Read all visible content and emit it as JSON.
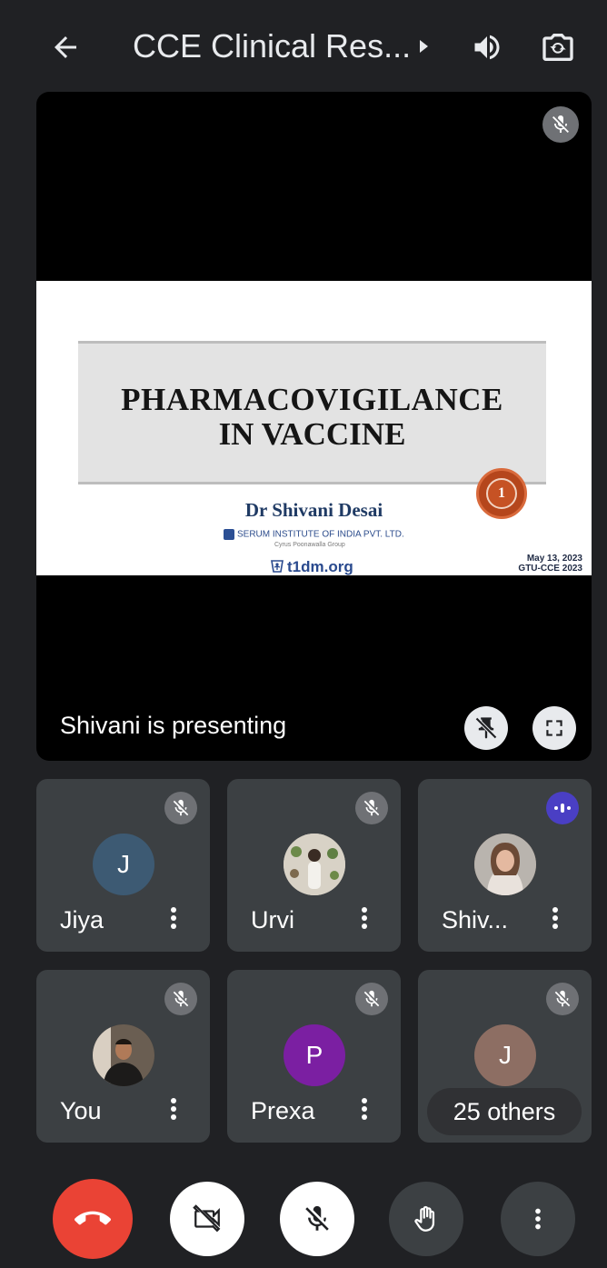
{
  "header": {
    "title": "CCE Clinical Res..."
  },
  "stage": {
    "slide": {
      "title_line1": "PHARMACOVIGILANCE",
      "title_line2": "IN VACCINE",
      "badge_number": "1",
      "author": "Dr Shivani Desai",
      "org": "SERUM INSTITUTE OF INDIA PVT. LTD.",
      "org_sub": "Cyrus Poonawalla Group",
      "site": "t1dm.org",
      "date_line1": "May 13, 2023",
      "date_line2": "GTU-CCE 2023"
    },
    "presenting_label": "Shivani is presenting"
  },
  "participants": [
    {
      "name": "Jiya",
      "initial": "J",
      "avatar_color": "#3d5a73",
      "state": "muted"
    },
    {
      "name": "Urvi",
      "initial": "",
      "avatar_color": "#c7c2b8",
      "state": "muted"
    },
    {
      "name": "Shiv...",
      "initial": "",
      "avatar_color": "#8a6b5c",
      "state": "speaking"
    },
    {
      "name": "You",
      "initial": "",
      "avatar_color": "#2c2a28",
      "state": "muted"
    },
    {
      "name": "Prexa",
      "initial": "P",
      "avatar_color": "#7b1fa2",
      "state": "muted"
    },
    {
      "name": "",
      "initial": "J",
      "avatar_color": "#8d6e63",
      "state": "muted",
      "others_label": "25 others"
    }
  ],
  "colors": {
    "background": "#202124",
    "tile": "#3c4043",
    "end_call": "#ea4335",
    "speaking": "#4a3fc4"
  }
}
